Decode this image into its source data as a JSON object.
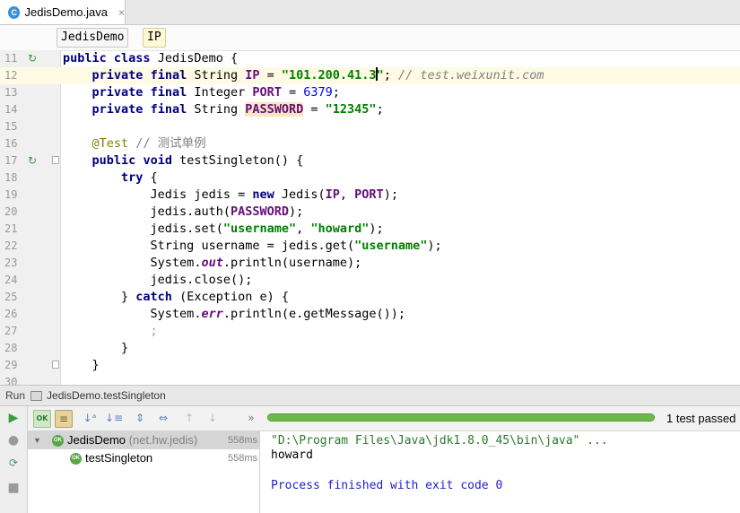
{
  "editor_tab": {
    "icon": "C",
    "filename": "JedisDemo.java",
    "close": "×"
  },
  "breadcrumbs": [
    "JedisDemo",
    "IP"
  ],
  "code_lines": [
    {
      "n": "11",
      "marker": "run-class"
    },
    {
      "n": "12"
    },
    {
      "n": "13"
    },
    {
      "n": "14"
    },
    {
      "n": "15"
    },
    {
      "n": "16"
    },
    {
      "n": "17",
      "marker": "run-method",
      "fold": true
    },
    {
      "n": "18"
    },
    {
      "n": "19"
    },
    {
      "n": "20"
    },
    {
      "n": "21"
    },
    {
      "n": "22"
    },
    {
      "n": "23"
    },
    {
      "n": "24"
    },
    {
      "n": "25"
    },
    {
      "n": "26"
    },
    {
      "n": "27"
    },
    {
      "n": "28"
    },
    {
      "n": "29",
      "fold": true
    },
    {
      "n": "30"
    }
  ],
  "code": {
    "l11": {
      "kw1": "public",
      "kw2": "class",
      "name": " JedisDemo {"
    },
    "l12": {
      "kw1": "private",
      "kw2": "final",
      "type": " String ",
      "field": "IP",
      "eq": " = ",
      "value_a": "\"101.200.41.3",
      "value_b": "\"",
      "semi": "; ",
      "comment": "// test.weixunit.com"
    },
    "l13": {
      "kw1": "private",
      "kw2": "final",
      "type": " Integer ",
      "field": "PORT",
      "eq": " = ",
      "value": "6379",
      "semi": ";"
    },
    "l14": {
      "kw1": "private",
      "kw2": "final",
      "type": " String ",
      "field": "PASSWORD",
      "eq": " = ",
      "value": "\"12345\"",
      "semi": ";"
    },
    "l16": {
      "annotation": "@Test",
      "comment": " // 测试单例"
    },
    "l17": {
      "kw1": "public",
      "kw2": "void",
      "rest": " testSingleton() {"
    },
    "l18": {
      "kw": "try",
      "rest": " {"
    },
    "l19": {
      "a": "Jedis jedis = ",
      "kw": "new",
      "b": " Jedis(",
      "f1": "IP",
      "c": ", ",
      "f2": "PORT",
      "d": ");"
    },
    "l20": {
      "a": "jedis.auth(",
      "f": "PASSWORD",
      "b": ");"
    },
    "l21": {
      "a": "jedis.set(",
      "s1": "\"username\"",
      "b": ", ",
      "s2": "\"howard\"",
      "c": ");"
    },
    "l22": {
      "a": "String username = jedis.get(",
      "s": "\"username\"",
      "b": ");"
    },
    "l23": {
      "a": "System.",
      "sf": "out",
      "b": ".println(username);"
    },
    "l24": {
      "a": "jedis.close();"
    },
    "l25": {
      "a": "} ",
      "kw": "catch",
      "b": " (Exception e) {"
    },
    "l26": {
      "a": "System.",
      "sf": "err",
      "b": ".println(e.getMessage());"
    },
    "l27": {
      "a": ";"
    },
    "l28": {
      "a": "}"
    },
    "l29": {
      "a": "}"
    }
  },
  "run_panel": {
    "label": "Run",
    "config": "JedisDemo.testSingleton",
    "status": "1 test passed",
    "progress_fraction": 1.0,
    "ok_badge": "OK",
    "tree": [
      {
        "name": "JedisDemo",
        "package": "(net.hw.jedis)",
        "time": "558ms"
      },
      {
        "name": "testSingleton",
        "time": "558ms"
      }
    ],
    "console": {
      "cmd": "\"D:\\Program Files\\Java\\jdk1.8.0_45\\bin\\java\" ...",
      "output": "howard",
      "exit": "Process finished with exit code 0"
    }
  },
  "colors": {
    "keyword": "#000080",
    "string": "#008000",
    "field": "#660e7a",
    "comment": "#808080",
    "number": "#0000ff",
    "annotation": "#808000",
    "console_cmd": "#2c7a2c",
    "console_exit": "#1f1fc8"
  }
}
